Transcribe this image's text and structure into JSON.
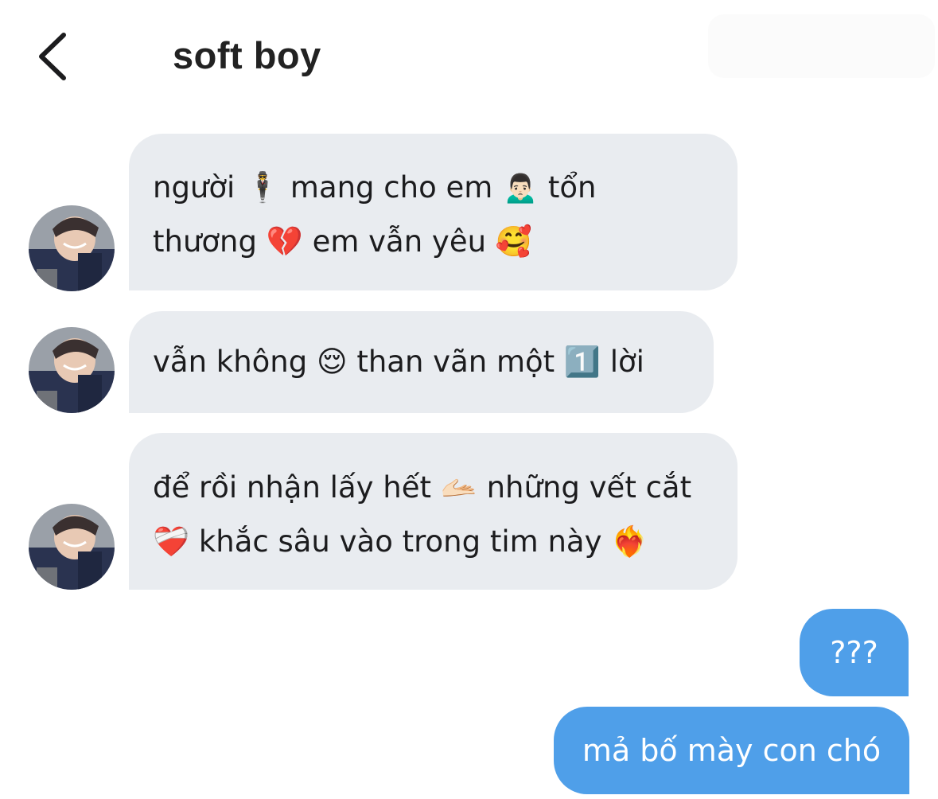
{
  "header": {
    "title": "soft boy",
    "back_icon": "chevron-left-icon"
  },
  "colors": {
    "incoming_bubble": "#e9ecf0",
    "outgoing_bubble": "#4f9fe9",
    "text": "#1c1c1e",
    "outgoing_text": "#ffffff"
  },
  "messages": [
    {
      "direction": "incoming",
      "lines": [
        "người 🕴 mang cho em 🙍🏻‍♂️ tổn",
        "thương 💔 em vẫn yêu 🥰"
      ]
    },
    {
      "direction": "incoming",
      "lines": [
        "vẫn không 😌 than vãn một 1️⃣ lời"
      ]
    },
    {
      "direction": "incoming",
      "lines": [
        "để rồi nhận lấy hết 🫴🏻 những vết cắt",
        "❤️‍🩹 khắc sâu vào trong tim này ❤️‍🔥"
      ]
    },
    {
      "direction": "outgoing",
      "text": "???"
    },
    {
      "direction": "outgoing",
      "text": "mả bố mày con chó"
    }
  ]
}
